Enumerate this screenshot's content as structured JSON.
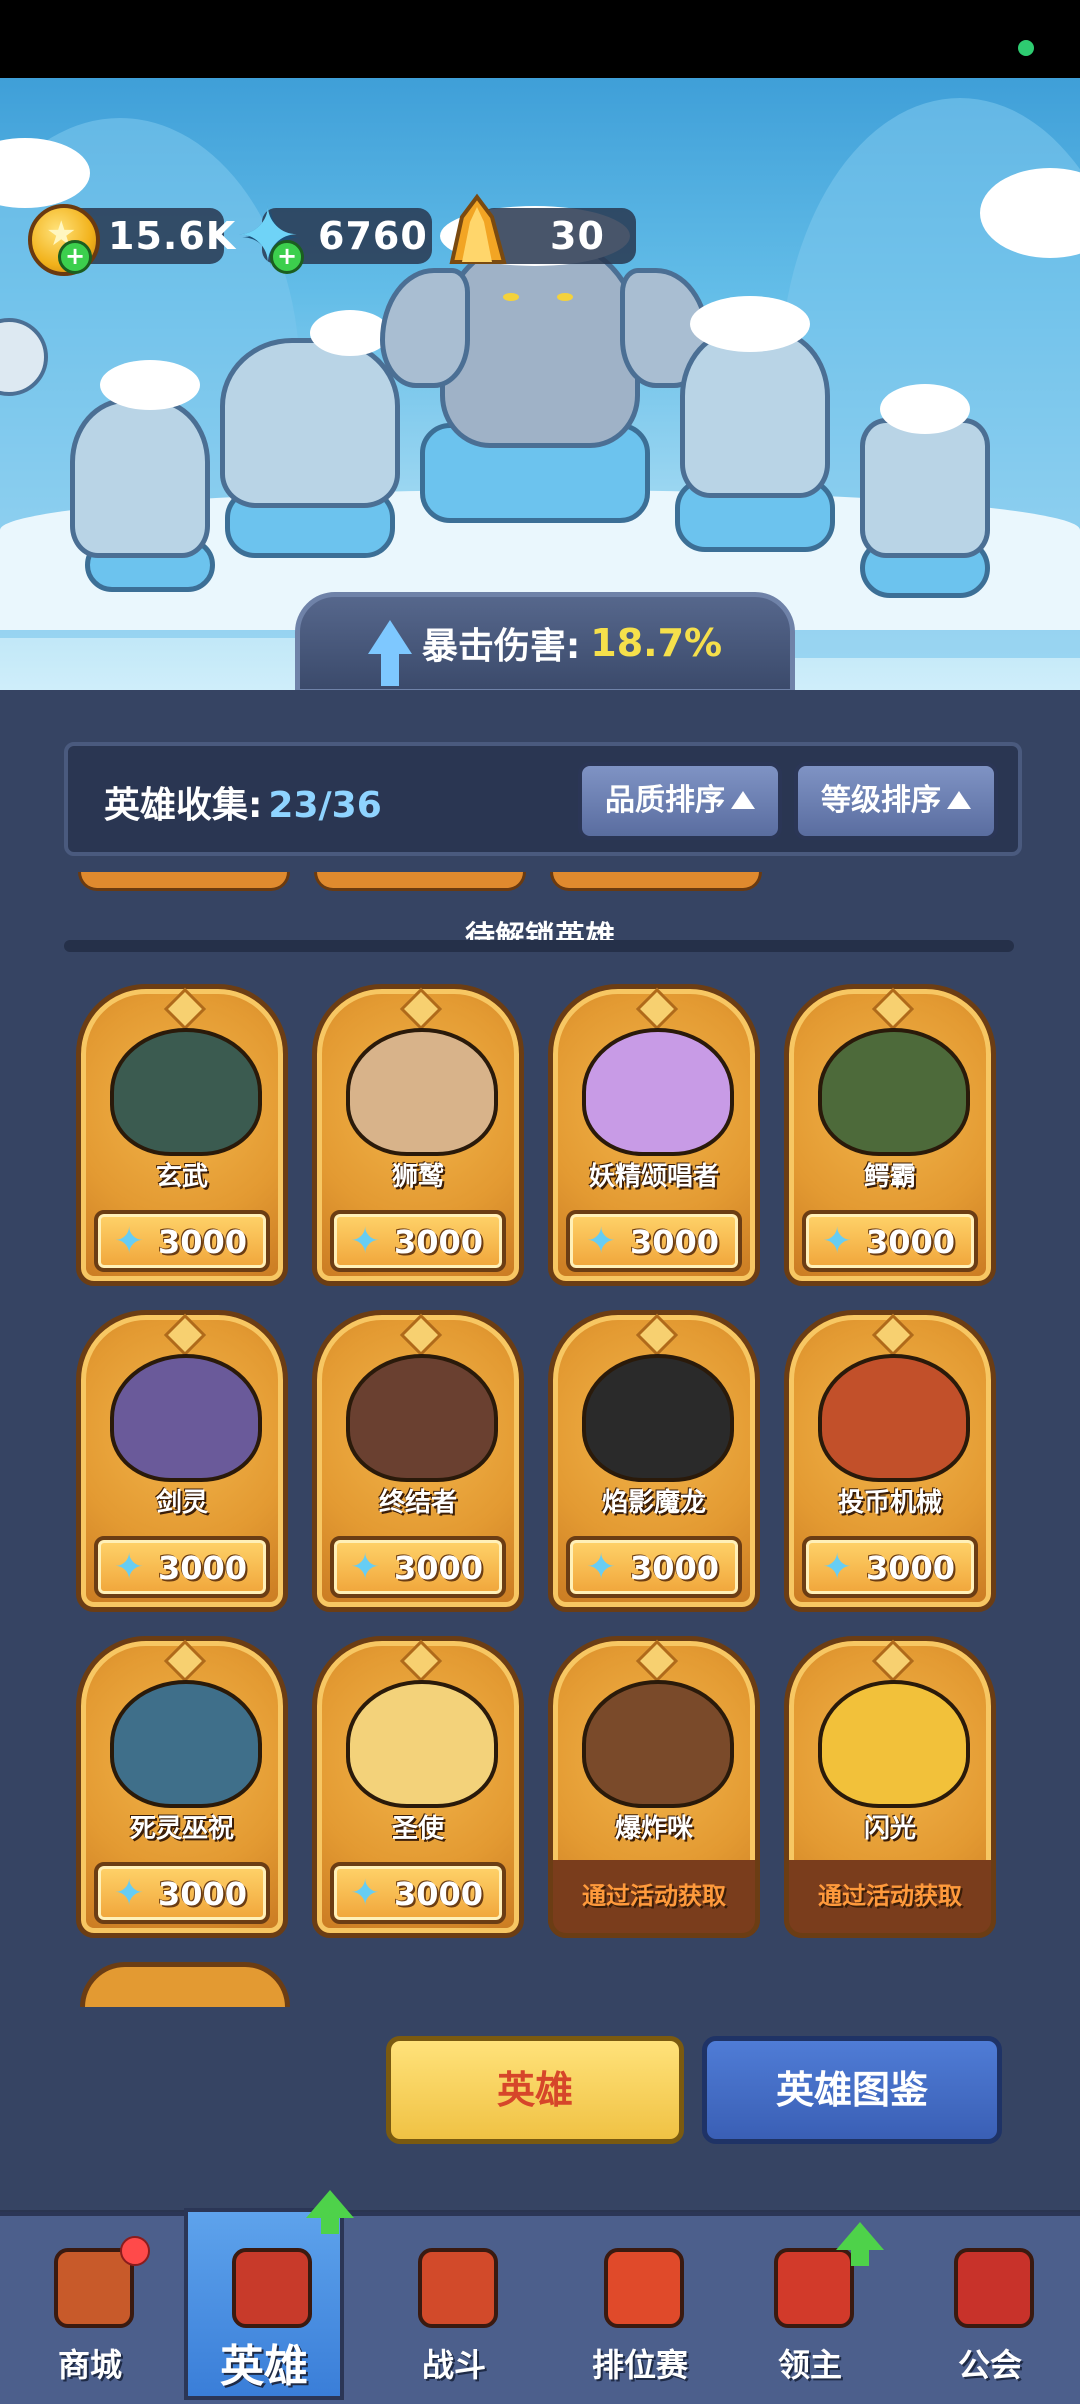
{
  "currency": {
    "gold": "15.6K",
    "gems": "6760",
    "crystals": "30"
  },
  "banner": {
    "crit_label": "暴击伤害:",
    "crit_value": "18.7%"
  },
  "collection": {
    "label": "英雄收集:",
    "value": "23/36",
    "sort_quality": "品质排序",
    "sort_level": "等级排序"
  },
  "section_title": "待解锁英雄",
  "heroes": [
    {
      "name": "玄武",
      "price": "3000"
    },
    {
      "name": "狮鹫",
      "price": "3000"
    },
    {
      "name": "妖精颂唱者",
      "price": "3000"
    },
    {
      "name": "鳄霸",
      "price": "3000"
    },
    {
      "name": "剑灵",
      "price": "3000"
    },
    {
      "name": "终结者",
      "price": "3000"
    },
    {
      "name": "焰影魔龙",
      "price": "3000"
    },
    {
      "name": "投币机械",
      "price": "3000"
    },
    {
      "name": "死灵巫祝",
      "price": "3000"
    },
    {
      "name": "圣使",
      "price": "3000"
    },
    {
      "name": "爆炸咪",
      "event": "通过活动获取"
    },
    {
      "name": "闪光",
      "event": "通过活动获取"
    }
  ],
  "actions": {
    "hero": "英雄",
    "codex": "英雄图鉴"
  },
  "nav": [
    {
      "label": "商城",
      "icon": "shop-chest-icon"
    },
    {
      "label": "英雄",
      "icon": "hero-card-icon"
    },
    {
      "label": "战斗",
      "icon": "battle-rocket-icon"
    },
    {
      "label": "排位赛",
      "icon": "ranked-knot-icon"
    },
    {
      "label": "领主",
      "icon": "lord-banner-icon"
    },
    {
      "label": "公会",
      "icon": "guild-hall-icon"
    }
  ],
  "colors": {
    "panel": "#364463",
    "card_orange": "#e39a32",
    "accent_yellow": "#f6e04b",
    "accent_blue": "#8fd4ff",
    "nav_active": "#3a7ed8"
  }
}
